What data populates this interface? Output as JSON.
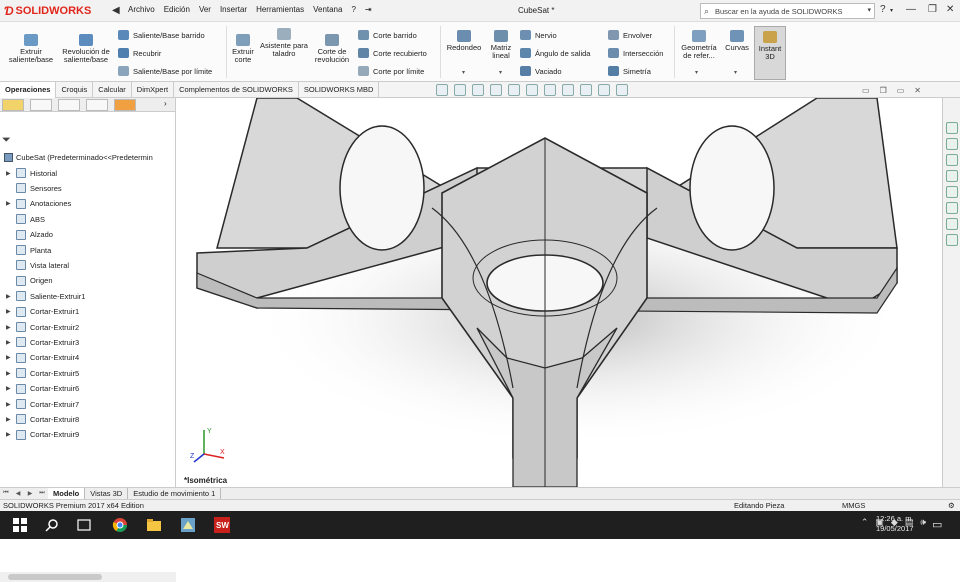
{
  "titlebar": {
    "brand": "SOLIDWORKS",
    "menus": [
      "Archivo",
      "Edición",
      "Ver",
      "Insertar",
      "Herramientas",
      "Ventana",
      "?"
    ],
    "pin_glyph": "⇥",
    "document_title": "CubeSat *",
    "search_placeholder": "Buscar en la ayuda de SOLIDWORKS"
  },
  "ribbon": {
    "extrude_boss": "Extruir saliente/base",
    "revolve_boss": "Revolución de saliente/base",
    "swept_boss": "Saliente/Base barrido",
    "loft_boss": "Recubrir",
    "boundary_boss": "Saliente/Base por límite",
    "extrude_cut": "Extruir corte",
    "hole_wizard": "Asistente para taladro",
    "revolve_cut": "Corte de revolución",
    "swept_cut": "Corte barrido",
    "loft_cut": "Corte recubierto",
    "boundary_cut": "Corte por límite",
    "fillet": "Redondeo",
    "linear_pattern": "Matriz lineal",
    "rib": "Nervio",
    "draft": "Ángulo de salida",
    "shell": "Vaciado",
    "wrap": "Envolver",
    "intersect": "Intersección",
    "mirror": "Simetría",
    "ref_geometry": "Geometría de refer...",
    "curves": "Curvas",
    "instant3d": "Instant 3D"
  },
  "command_tabs": [
    "Operaciones",
    "Croquis",
    "Calcular",
    "DimXpert",
    "Complementos de SOLIDWORKS",
    "SOLIDWORKS MBD"
  ],
  "active_command_tab": "Operaciones",
  "feature_manager": {
    "root": "CubeSat  (Predeterminado<<Predetermin",
    "items": [
      {
        "label": "Historial",
        "expand": "▶"
      },
      {
        "label": "Sensores",
        "expand": ""
      },
      {
        "label": "Anotaciones",
        "expand": "▶"
      },
      {
        "label": "ABS",
        "expand": ""
      },
      {
        "label": "Alzado",
        "expand": ""
      },
      {
        "label": "Planta",
        "expand": ""
      },
      {
        "label": "Vista lateral",
        "expand": ""
      },
      {
        "label": "Origen",
        "expand": ""
      },
      {
        "label": "Saliente-Extruir1",
        "expand": "▶"
      },
      {
        "label": "Cortar-Extruir1",
        "expand": "▶"
      },
      {
        "label": "Cortar-Extruir2",
        "expand": "▶"
      },
      {
        "label": "Cortar-Extruir3",
        "expand": "▶"
      },
      {
        "label": "Cortar-Extruir4",
        "expand": "▶"
      },
      {
        "label": "Cortar-Extruir5",
        "expand": "▶"
      },
      {
        "label": "Cortar-Extruir6",
        "expand": "▶"
      },
      {
        "label": "Cortar-Extruir7",
        "expand": "▶"
      },
      {
        "label": "Cortar-Extruir8",
        "expand": "▶"
      },
      {
        "label": "Cortar-Extruir9",
        "expand": "▶"
      }
    ]
  },
  "viewport": {
    "view_label": "*Isométrica",
    "triad_axes": [
      "X",
      "Y",
      "Z"
    ]
  },
  "bottom_tabs": [
    "Modelo",
    "Vistas 3D",
    "Estudio de movimiento 1"
  ],
  "active_bottom_tab": "Modelo",
  "status": {
    "edition": "SOLIDWORKS Premium 2017 x64 Edition",
    "mode": "Editando Pieza",
    "units": "MMGS"
  },
  "taskbar": {
    "time": "12:26 a. m.",
    "date": "19/05/2017"
  },
  "colors": {
    "brand_red": "#e1261c",
    "part_face": "#d0d0d0",
    "part_edge": "#2a2a2a",
    "taskbar": "#1f1f1f"
  }
}
